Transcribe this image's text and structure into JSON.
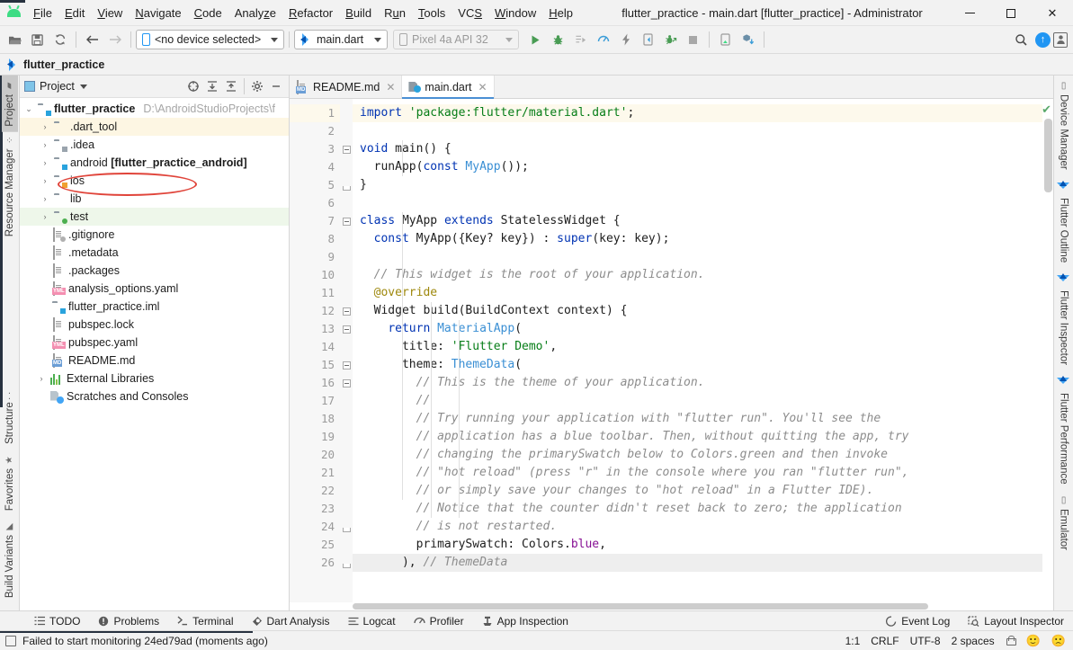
{
  "window": {
    "title": "flutter_practice - main.dart [flutter_practice] - Administrator",
    "minimize_label": "—",
    "maximize_label": "□",
    "close_label": "✕"
  },
  "menu": {
    "items": [
      {
        "label": "File"
      },
      {
        "label": "Edit"
      },
      {
        "label": "View"
      },
      {
        "label": "Navigate"
      },
      {
        "label": "Code"
      },
      {
        "label": "Analyze"
      },
      {
        "label": "Refactor"
      },
      {
        "label": "Build"
      },
      {
        "label": "Run"
      },
      {
        "label": "Tools"
      },
      {
        "label": "VCS"
      },
      {
        "label": "Window"
      },
      {
        "label": "Help"
      }
    ]
  },
  "toolbar": {
    "open_icon": "open-folder-icon",
    "save_icon": "save-icon",
    "sync_icon": "sync-icon",
    "back_icon": "back-arrow-icon",
    "forward_icon": "forward-arrow-icon",
    "device_selector": "<no device selected>",
    "run_config": "main.dart",
    "emulator_target": "Pixel 4a API 32",
    "run_icon": "run-icon",
    "debug_icon": "debug-icon",
    "run_coverage_icon": "run-with-coverage-icon",
    "profile_icon": "profile-icon",
    "hot_reload_icon": "hot-reload-icon",
    "device_file_icon": "flutter-attach-icon",
    "debug_attach_icon": "attach-debugger-icon",
    "stop_icon": "stop-icon",
    "device_manager_icon": "device-manager-icon",
    "pub_get_icon": "pub-get-icon",
    "search_icon": "search-icon",
    "updates_icon": "updates-available-icon",
    "account_icon": "account-icon"
  },
  "navbar": {
    "project_name": "flutter_practice",
    "icon": "flutter-icon"
  },
  "left_strip": {
    "tabs": [
      {
        "label": "Project",
        "icon": "project-folder-icon",
        "active": true
      },
      {
        "label": "Resource Manager",
        "icon": "resource-manager-icon",
        "active": false
      },
      {
        "label": "Structure",
        "icon": "structure-icon",
        "active": false
      },
      {
        "label": "Favorites",
        "icon": "star-icon",
        "active": false
      },
      {
        "label": "Build Variants",
        "icon": "build-variants-icon",
        "active": false
      }
    ]
  },
  "right_strip": {
    "tabs": [
      {
        "label": "Device Manager",
        "icon": "device-manager-icon"
      },
      {
        "label": "Flutter Outline",
        "icon": "flutter-icon"
      },
      {
        "label": "Flutter Inspector",
        "icon": "flutter-icon"
      },
      {
        "label": "Flutter Performance",
        "icon": "flutter-icon"
      },
      {
        "label": "Emulator",
        "icon": "emulator-icon"
      }
    ]
  },
  "project_panel": {
    "title": "Project",
    "title_icon": "project-view-icon",
    "actions": [
      {
        "name": "select-opened-file-icon",
        "glyph": "⊕"
      },
      {
        "name": "expand-all-icon",
        "glyph": "⤓"
      },
      {
        "name": "collapse-all-icon",
        "glyph": "⤒"
      },
      {
        "name": "settings-gear-icon",
        "glyph": "⚙"
      },
      {
        "name": "hide-panel-icon",
        "glyph": "—"
      }
    ],
    "tree": [
      {
        "label": "flutter_practice",
        "path": "D:\\AndroidStudioProjects\\f",
        "indent": 1,
        "arrow": "open",
        "icon": "folder-module",
        "bold": true,
        "highlight": "none",
        "annotated": true
      },
      {
        "label": ".dart_tool",
        "indent": 2,
        "arrow": "closed",
        "icon": "folder-orange",
        "highlight": "yellow"
      },
      {
        "label": ".idea",
        "indent": 2,
        "arrow": "closed",
        "icon": "folder-idea",
        "highlight": "none"
      },
      {
        "label": "android [flutter_practice_android]",
        "indent": 2,
        "arrow": "closed",
        "icon": "folder-module",
        "highlight": "none",
        "bold_suffix": true
      },
      {
        "label": "ios",
        "indent": 2,
        "arrow": "closed",
        "icon": "folder-ios",
        "highlight": "none"
      },
      {
        "label": "lib",
        "indent": 2,
        "arrow": "closed",
        "icon": "folder-blue",
        "highlight": "none"
      },
      {
        "label": "test",
        "indent": 2,
        "arrow": "closed",
        "icon": "folder-test",
        "highlight": "green"
      },
      {
        "label": ".gitignore",
        "indent": 2,
        "arrow": "none",
        "icon": "file-ignored",
        "highlight": "none"
      },
      {
        "label": ".metadata",
        "indent": 2,
        "arrow": "none",
        "icon": "file-text",
        "highlight": "none"
      },
      {
        "label": ".packages",
        "indent": 2,
        "arrow": "none",
        "icon": "file-text",
        "highlight": "none"
      },
      {
        "label": "analysis_options.yaml",
        "indent": 2,
        "arrow": "none",
        "icon": "file-yaml",
        "highlight": "none"
      },
      {
        "label": "flutter_practice.iml",
        "indent": 2,
        "arrow": "none",
        "icon": "file-iml",
        "highlight": "none"
      },
      {
        "label": "pubspec.lock",
        "indent": 2,
        "arrow": "none",
        "icon": "file-text",
        "highlight": "none"
      },
      {
        "label": "pubspec.yaml",
        "indent": 2,
        "arrow": "none",
        "icon": "file-yaml",
        "highlight": "none"
      },
      {
        "label": "README.md",
        "indent": 2,
        "arrow": "none",
        "icon": "file-md",
        "highlight": "none"
      },
      {
        "label": "External Libraries",
        "indent": 1,
        "arrow": "closed",
        "icon": "libraries",
        "highlight": "none"
      },
      {
        "label": "Scratches and Consoles",
        "indent": 1,
        "arrow": "none",
        "icon": "scratches",
        "highlight": "none"
      }
    ]
  },
  "editor": {
    "tabs": [
      {
        "label": "README.md",
        "icon": "markdown-file-icon",
        "active": false,
        "close": "✕"
      },
      {
        "label": "main.dart",
        "icon": "dart-file-icon",
        "active": true,
        "close": "✕"
      }
    ],
    "inspection_status_icon": "no-problems-checkmark",
    "lines": [
      {
        "n": 1,
        "text": "import 'package:flutter/material.dart';",
        "highlight": true
      },
      {
        "n": 2,
        "text": ""
      },
      {
        "n": 3,
        "text": "void main() {",
        "gutter_icon": "run-main-icon",
        "fold": "open"
      },
      {
        "n": 4,
        "text": "  runApp(const MyApp());"
      },
      {
        "n": 5,
        "text": "}",
        "fold": "end"
      },
      {
        "n": 6,
        "text": ""
      },
      {
        "n": 7,
        "text": "class MyApp extends StatelessWidget {",
        "fold": "open"
      },
      {
        "n": 8,
        "text": "  const MyApp({Key? key}) : super(key: key);"
      },
      {
        "n": 9,
        "text": ""
      },
      {
        "n": 10,
        "text": "  // This widget is the root of your application."
      },
      {
        "n": 11,
        "text": "  @override"
      },
      {
        "n": 12,
        "text": "  Widget build(BuildContext context) {",
        "gutter_icon": "override-method-icon",
        "fold": "open"
      },
      {
        "n": 13,
        "text": "    return MaterialApp(",
        "fold": "open"
      },
      {
        "n": 14,
        "text": "      title: 'Flutter Demo',"
      },
      {
        "n": 15,
        "text": "      theme: ThemeData(",
        "fold": "open"
      },
      {
        "n": 16,
        "text": "        // This is the theme of your application.",
        "fold": "open"
      },
      {
        "n": 17,
        "text": "        //"
      },
      {
        "n": 18,
        "text": "        // Try running your application with \"flutter run\". You'll see the"
      },
      {
        "n": 19,
        "text": "        // application has a blue toolbar. Then, without quitting the app, try"
      },
      {
        "n": 20,
        "text": "        // changing the primarySwatch below to Colors.green and then invoke"
      },
      {
        "n": 21,
        "text": "        // \"hot reload\" (press \"r\" in the console where you ran \"flutter run\","
      },
      {
        "n": 22,
        "text": "        // or simply save your changes to \"hot reload\" in a Flutter IDE)."
      },
      {
        "n": 23,
        "text": "        // Notice that the counter didn't reset back to zero; the application"
      },
      {
        "n": 24,
        "text": "        // is not restarted.",
        "fold": "end"
      },
      {
        "n": 25,
        "text": "        primarySwatch: Colors.blue,",
        "gutter_icon": "color-swatch-blue"
      },
      {
        "n": 26,
        "text": "      ), // ThemeData",
        "fold": "end",
        "current": true
      }
    ]
  },
  "bottom_bar": {
    "tabs": [
      {
        "label": "TODO",
        "icon": "todo-icon"
      },
      {
        "label": "Problems",
        "icon": "problems-icon"
      },
      {
        "label": "Terminal",
        "icon": "terminal-icon"
      },
      {
        "label": "Dart Analysis",
        "icon": "dart-analysis-icon"
      },
      {
        "label": "Logcat",
        "icon": "logcat-icon"
      },
      {
        "label": "Profiler",
        "icon": "profiler-icon"
      },
      {
        "label": "App Inspection",
        "icon": "app-inspection-icon"
      }
    ],
    "right_tabs": [
      {
        "label": "Event Log",
        "icon": "event-log-icon"
      },
      {
        "label": "Layout Inspector",
        "icon": "layout-inspector-icon"
      }
    ]
  },
  "status_bar": {
    "message": "Failed to start monitoring 24ed79ad (moments ago)",
    "message_icon": "notification-icon",
    "caret_position": "1:1",
    "line_separator": "CRLF",
    "encoding": "UTF-8",
    "indent": "2 spaces",
    "lock_icon": "read-only-lock-icon",
    "happy_icon": "🙂",
    "sad_icon": "🙁"
  },
  "colors": {
    "accent_blue": "#2196f3",
    "annotation_red": "#e0443a",
    "ok_green": "#59a869",
    "toolbar_bg": "#f2f2f2",
    "editor_bg": "#ffffff",
    "highlight_yellow": "#fdf9ec",
    "row_green": "#eef7ea"
  }
}
